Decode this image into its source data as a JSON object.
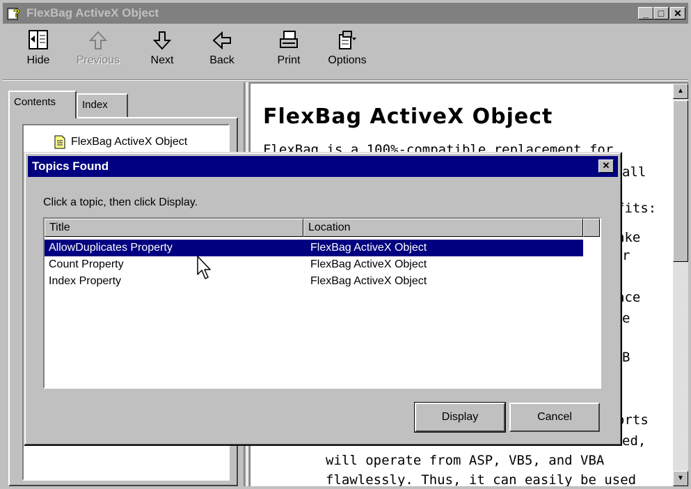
{
  "window": {
    "title": "FlexBag ActiveX Object",
    "caption_buttons": [
      "minimize",
      "maximize",
      "close"
    ]
  },
  "toolbar": {
    "hide": "Hide",
    "previous": "Previous",
    "next": "Next",
    "back": "Back",
    "print": "Print",
    "options": "Options"
  },
  "tabs": {
    "contents": "Contents",
    "index": "Index"
  },
  "tree": {
    "item": "FlexBag ActiveX Object"
  },
  "document": {
    "heading": "FlexBag ActiveX Object",
    "lines": [
      "FlexBag is a 100%-compatible replacement for",
      "all",
      "fits:",
      "ake",
      "r",
      "ace",
      "e",
      "B",
      "orts",
      "ed,",
      "will operate from ASP, VB5, and VBA",
      "flawlessly. Thus, it can easily be used"
    ]
  },
  "dialog": {
    "title": "Topics Found",
    "instruction": "Click a topic, then click Display.",
    "columns": {
      "title": "Title",
      "location": "Location"
    },
    "rows": [
      {
        "title": "AllowDuplicates Property",
        "location": "FlexBag ActiveX Object",
        "selected": true
      },
      {
        "title": "Count Property",
        "location": "FlexBag ActiveX Object",
        "selected": false
      },
      {
        "title": "Index Property",
        "location": "FlexBag ActiveX Object",
        "selected": false
      }
    ],
    "display_label": "Display",
    "cancel_label": "Cancel"
  },
  "colors": {
    "active_title": "#000080",
    "inactive_title": "#808080",
    "face": "#c0c0c0",
    "selection": "#000080"
  }
}
